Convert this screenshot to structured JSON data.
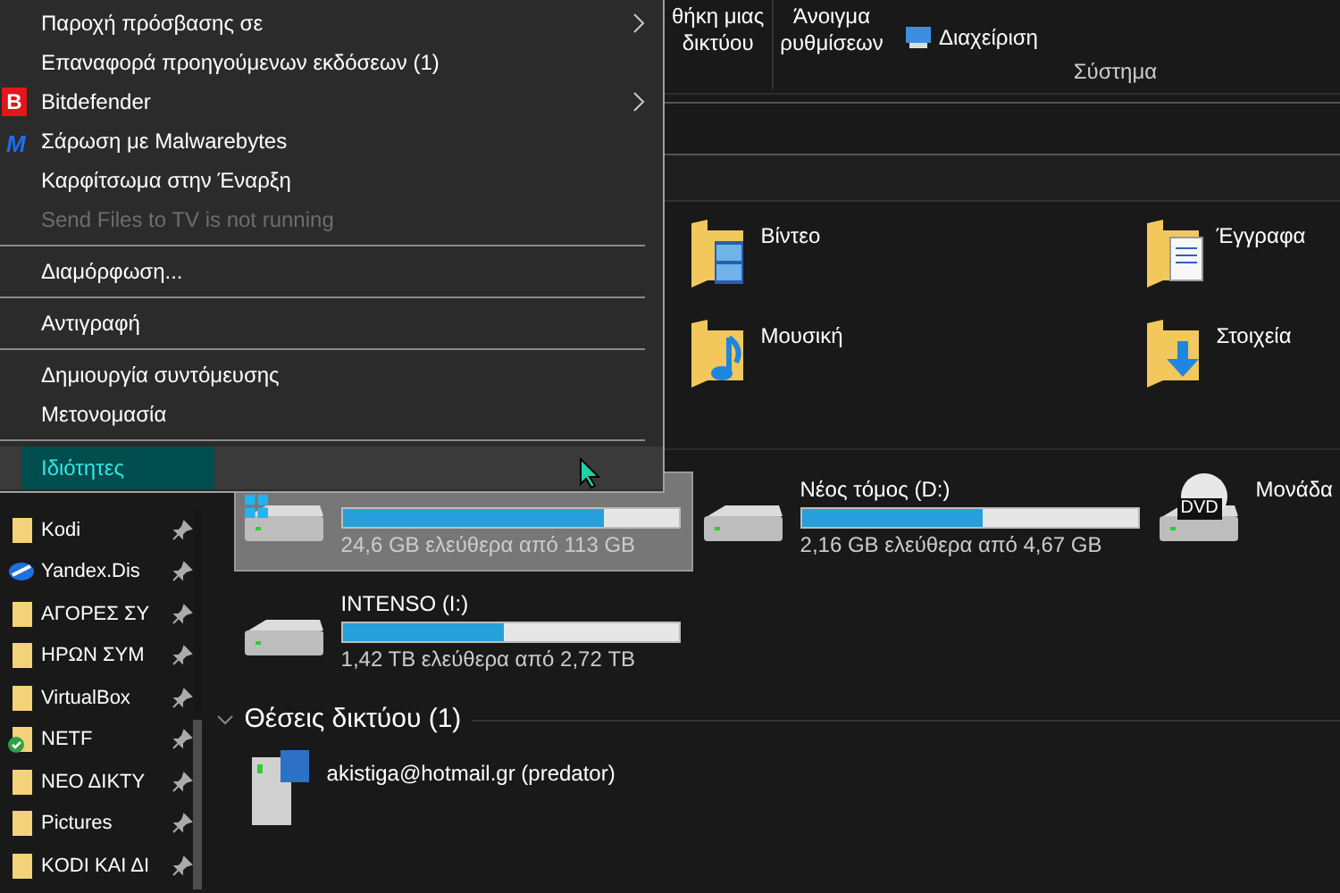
{
  "ribbon": {
    "buttons": [
      {
        "lines": [
          "θήκη μιας",
          "δικτύου"
        ]
      },
      {
        "lines": [
          "Άνοιγμα",
          "ρυθμίσεων"
        ]
      }
    ],
    "small_button": {
      "label": "Διαχείριση"
    },
    "group_label": "Σύστημα"
  },
  "sidebar": {
    "items": [
      {
        "label": "Kodi",
        "kind": "folder",
        "pinned": true
      },
      {
        "label": "Yandex.Dis",
        "kind": "cloud",
        "pinned": true
      },
      {
        "label": "ΑΓΟΡΕΣ ΣΥ",
        "kind": "folder",
        "pinned": true
      },
      {
        "label": "ΗΡΩΝ ΣΥΜ",
        "kind": "folder",
        "pinned": true
      },
      {
        "label": "VirtualBox",
        "kind": "folder",
        "pinned": true
      },
      {
        "label": "NETF",
        "kind": "synced",
        "pinned": true
      },
      {
        "label": "ΝΕΟ ΔΙΚΤΥ",
        "kind": "folder",
        "pinned": true
      },
      {
        "label": "Pictures",
        "kind": "folder",
        "pinned": true
      },
      {
        "label": "KODI ΚΑΙ ΔΙ",
        "kind": "folder",
        "pinned": true
      }
    ]
  },
  "folders": [
    {
      "name": "Βίντεο",
      "kind": "video"
    },
    {
      "name": "Έγγραφα",
      "kind": "documents"
    },
    {
      "name": "Μουσική",
      "kind": "music"
    },
    {
      "name": "Στοιχεία",
      "kind": "downloads"
    }
  ],
  "drives": [
    {
      "kind": "system",
      "free_text": "24,6 GB ελεύθερα από 113 GB",
      "level": 0.78,
      "selected": true
    },
    {
      "name": "Νέος τόμος (D:)",
      "kind": "disk",
      "free_text": "2,16 GB ελεύθερα από 4,67 GB",
      "level": 0.54,
      "selected": false
    },
    {
      "name": "Μονάδα",
      "kind": "dvd",
      "disc_label": "DVD",
      "selected": false
    },
    {
      "name": "INTENSO (I:)",
      "kind": "disk",
      "free_text": "1,42 TB ελεύθερα από 2,72 TB",
      "level": 0.48,
      "selected": false
    }
  ],
  "network": {
    "title": "Θέσεις δικτύου (1)",
    "expanded": true,
    "items": [
      {
        "name": "akistiga@hotmail.gr (predator)"
      }
    ]
  },
  "context_menu": {
    "items": [
      {
        "kind": "item",
        "label": "Παροχή πρόσβασης σε",
        "submenu": true,
        "disabled": false,
        "selected": false
      },
      {
        "kind": "item",
        "label": "Επαναφορά προηγούμενων εκδόσεων (1)",
        "submenu": false,
        "disabled": false,
        "selected": false
      },
      {
        "kind": "item",
        "label": "Bitdefender",
        "submenu": true,
        "disabled": false,
        "selected": false,
        "badge": {
          "kind": "tile",
          "text": "B"
        }
      },
      {
        "kind": "item",
        "label": "Σάρωση με Malwarebytes",
        "submenu": false,
        "disabled": false,
        "selected": false,
        "badge": {
          "kind": "mark",
          "text": "M"
        }
      },
      {
        "kind": "item",
        "label": "Καρφίτσωμα στην Έναρξη",
        "submenu": false,
        "disabled": false,
        "selected": false
      },
      {
        "kind": "item",
        "label": "Send Files to TV is not running",
        "submenu": false,
        "disabled": true,
        "selected": false
      },
      {
        "kind": "separator"
      },
      {
        "kind": "item",
        "label": "Διαμόρφωση...",
        "submenu": false,
        "disabled": false,
        "selected": false
      },
      {
        "kind": "separator"
      },
      {
        "kind": "item",
        "label": "Αντιγραφή",
        "submenu": false,
        "disabled": false,
        "selected": false
      },
      {
        "kind": "separator"
      },
      {
        "kind": "item",
        "label": "Δημιουργία συντόμευσης",
        "submenu": false,
        "disabled": false,
        "selected": false
      },
      {
        "kind": "item",
        "label": "Μετονομασία",
        "submenu": false,
        "disabled": false,
        "selected": false
      },
      {
        "kind": "separator"
      },
      {
        "kind": "item",
        "label": "Ιδιότητες",
        "submenu": false,
        "disabled": false,
        "selected": true
      }
    ]
  }
}
